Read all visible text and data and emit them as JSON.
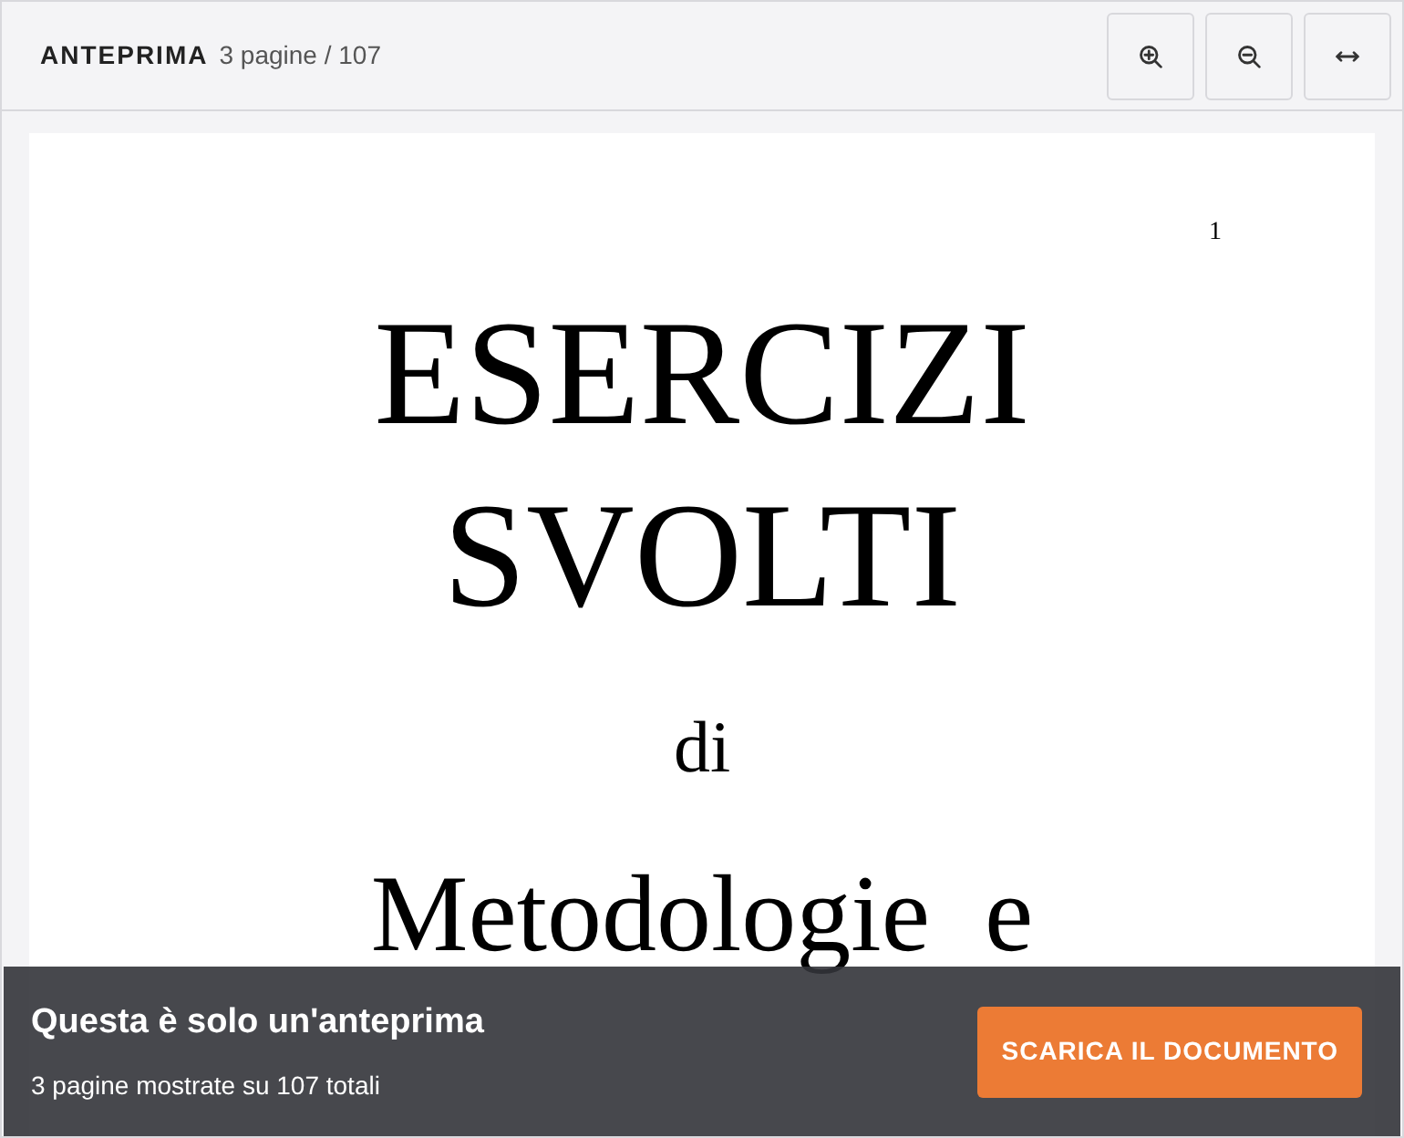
{
  "header": {
    "title": "ANTEPRIMA",
    "page_count": "3 pagine / 107"
  },
  "toolbar": [
    {
      "kind": "zoom-in"
    },
    {
      "kind": "zoom-out"
    },
    {
      "kind": "fit-width"
    }
  ],
  "document": {
    "page_number": "1",
    "lines": [
      {
        "kind": "title",
        "text": "ESERCIZI"
      },
      {
        "kind": "title",
        "text": "SVOLTI"
      },
      {
        "kind": "small",
        "text": "di"
      },
      {
        "kind": "subtitle",
        "text": "Metodologie  e"
      }
    ]
  },
  "banner": {
    "title": "Questa è solo un'anteprima",
    "subtitle": "3 pagine mostrate su 107 totali",
    "button": "SCARICA IL DOCUMENTO"
  }
}
